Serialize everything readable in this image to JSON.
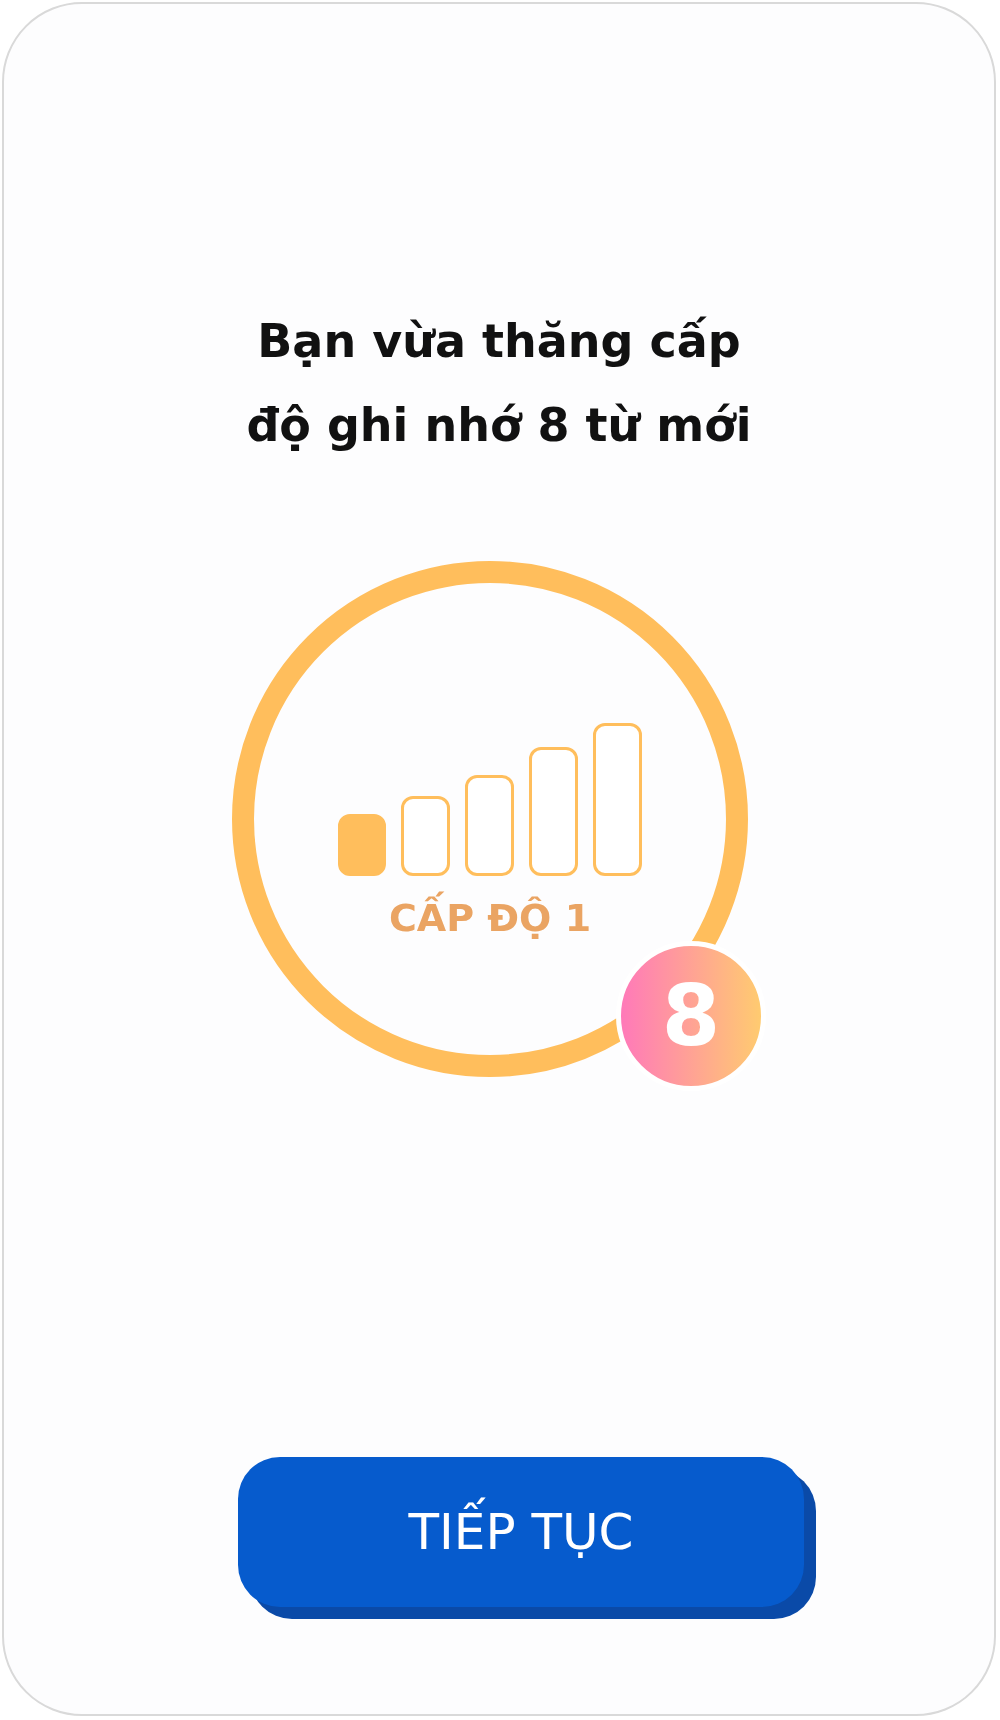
{
  "title": "Bạn vừa thăng cấp\nđộ ghi nhớ 8 từ mới",
  "level_label": "CẤP ĐỘ 1",
  "bars": [
    {
      "filled": true
    },
    {
      "filled": false
    },
    {
      "filled": false
    },
    {
      "filled": false
    },
    {
      "filled": false
    }
  ],
  "badge": "8",
  "button": "TIẾP TỤC"
}
